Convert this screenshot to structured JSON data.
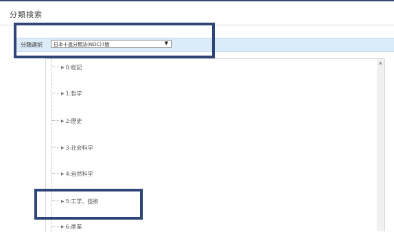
{
  "window": {
    "title": "分類検索"
  },
  "classification_select": {
    "label": "分類選択",
    "value": "日本十進分類法(NDC)7版",
    "arrow": "▼"
  },
  "tree": {
    "items": [
      {
        "label": "0:総記"
      },
      {
        "label": "1:哲学"
      },
      {
        "label": "2:歴史"
      },
      {
        "label": "3:社会科学"
      },
      {
        "label": "4:自然科学"
      },
      {
        "label": "5:工学、技術"
      },
      {
        "label": "6:産業"
      }
    ]
  },
  "colors": {
    "highlight_border": "#2e4577",
    "select_bar_bg": "#dcebf8"
  }
}
